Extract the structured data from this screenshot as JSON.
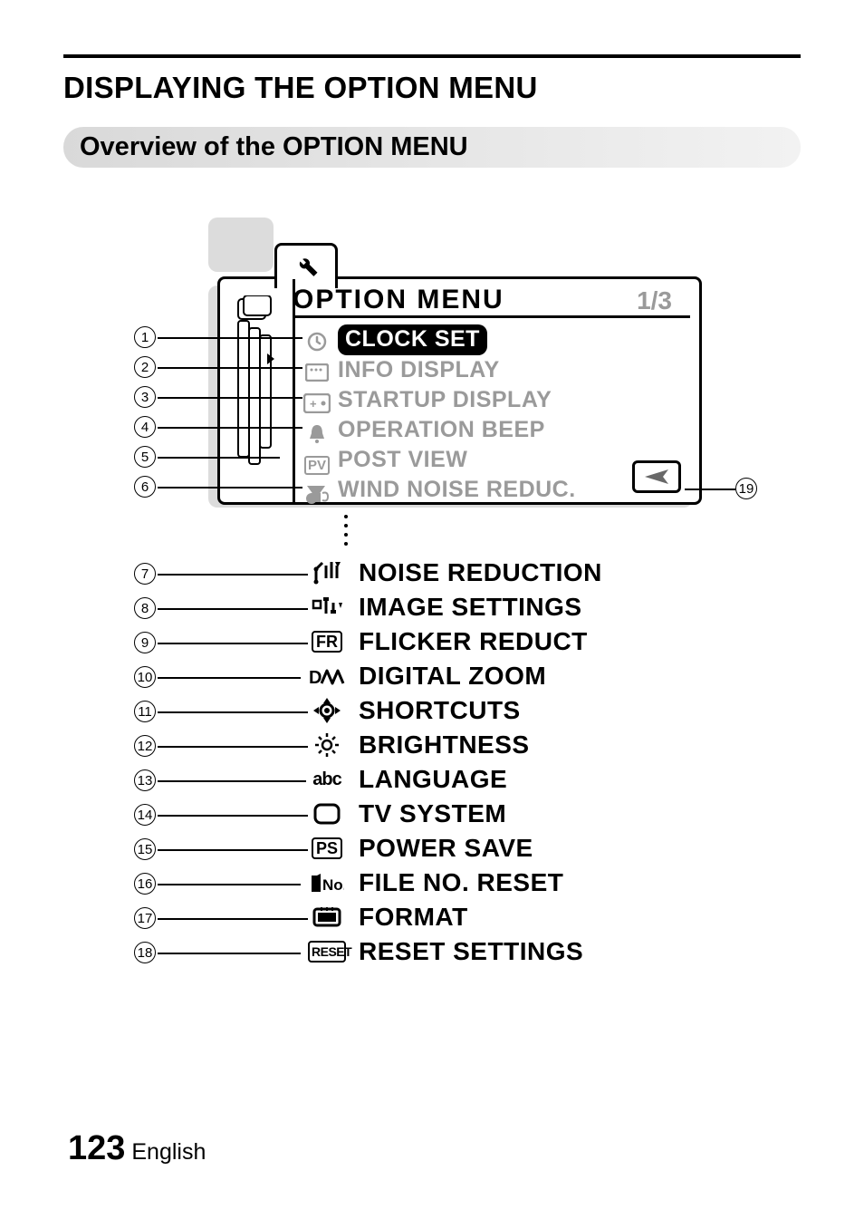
{
  "page_title": "DISPLAYING THE OPTION MENU",
  "subhead": "Overview of the OPTION MENU",
  "screen": {
    "title": "OPTION MENU",
    "page_indicator": "1/3",
    "items": [
      {
        "n": 1,
        "label": "CLOCK SET",
        "icon": "clock-icon"
      },
      {
        "n": 2,
        "label": "INFO DISPLAY",
        "icon": "info-display-icon"
      },
      {
        "n": 3,
        "label": "STARTUP DISPLAY",
        "icon": "startup-display-icon"
      },
      {
        "n": 4,
        "label": "OPERATION BEEP",
        "icon": "operation-beep-icon"
      },
      {
        "n": 5,
        "label": "POST VIEW",
        "icon": "pv-icon",
        "icon_text": "PV"
      },
      {
        "n": 6,
        "label": "WIND NOISE REDUC.",
        "icon": "wind-noise-icon"
      }
    ],
    "enter_callout": 19
  },
  "extra_items": [
    {
      "n": 7,
      "label": "NOISE REDUCTION",
      "icon": "noise-reduction-icon"
    },
    {
      "n": 8,
      "label": "IMAGE SETTINGS",
      "icon": "image-settings-icon"
    },
    {
      "n": 9,
      "label": "FLICKER REDUCT",
      "icon": "fr-icon",
      "icon_text": "FR"
    },
    {
      "n": 10,
      "label": "DIGITAL ZOOM",
      "icon": "digital-zoom-icon",
      "icon_text": "D"
    },
    {
      "n": 11,
      "label": "SHORTCUTS",
      "icon": "shortcuts-icon"
    },
    {
      "n": 12,
      "label": "BRIGHTNESS",
      "icon": "brightness-icon"
    },
    {
      "n": 13,
      "label": "LANGUAGE",
      "icon": "language-icon",
      "icon_text": "abc"
    },
    {
      "n": 14,
      "label": "TV SYSTEM",
      "icon": "tv-system-icon"
    },
    {
      "n": 15,
      "label": "POWER SAVE",
      "icon": "ps-icon",
      "icon_text": "PS"
    },
    {
      "n": 16,
      "label": "FILE NO. RESET",
      "icon": "file-no-reset-icon",
      "icon_text": "No."
    },
    {
      "n": 17,
      "label": "FORMAT",
      "icon": "format-icon"
    },
    {
      "n": 18,
      "label": "RESET SETTINGS",
      "icon": "reset-icon",
      "icon_text": "RESET"
    }
  ],
  "footer": {
    "page_number": "123",
    "lang": "English"
  }
}
